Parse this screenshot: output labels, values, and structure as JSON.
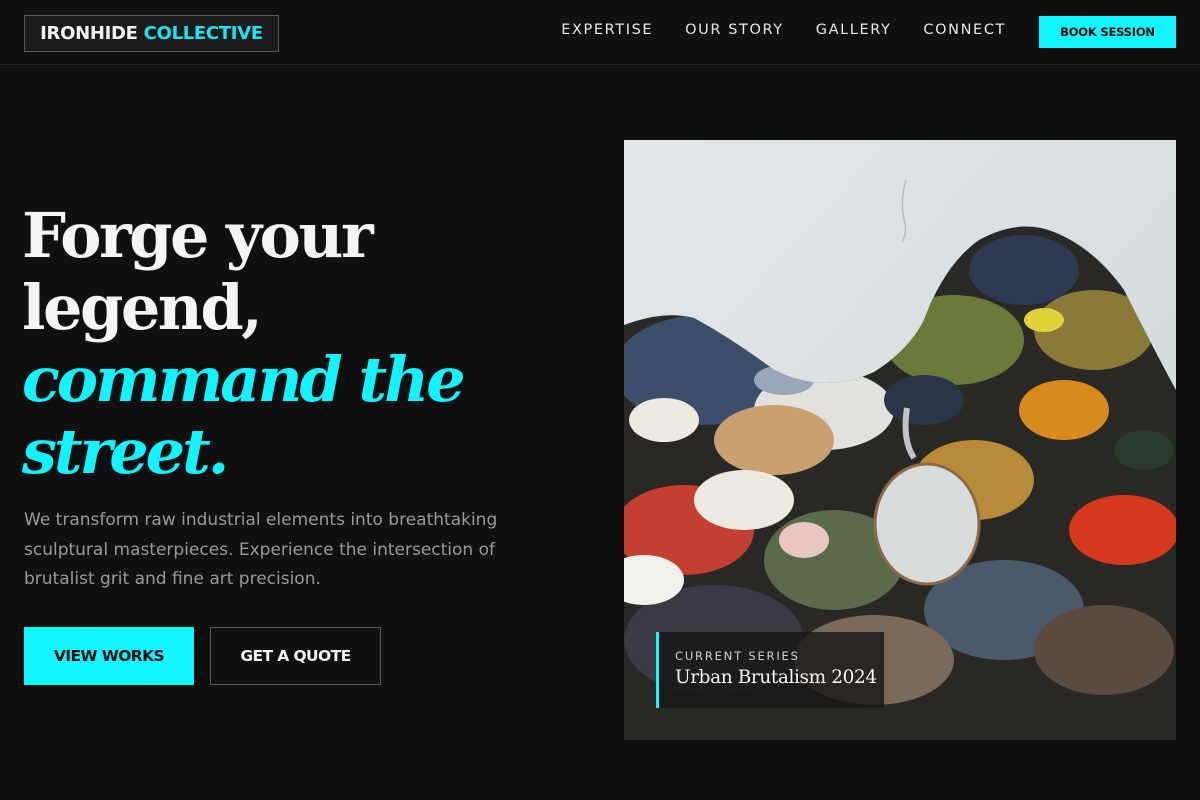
{
  "brand": {
    "name_part1": "IRONHIDE",
    "name_part2": "COLLECTIVE"
  },
  "nav": {
    "items": [
      {
        "label": "EXPERTISE"
      },
      {
        "label": "OUR STORY"
      },
      {
        "label": "GALLERY"
      },
      {
        "label": "CONNECT"
      }
    ],
    "cta_label": "BOOK SESSION"
  },
  "hero": {
    "headline_line1": "Forge your",
    "headline_line2": "legend,",
    "headline_accent1": "command the",
    "headline_accent2": "street.",
    "description": "We transform raw industrial elements into breathtaking sculptural masterpieces. Experience the intersection of brutalist grit and fine art precision.",
    "primary_button": "VIEW WORKS",
    "secondary_button": "GET A QUOTE"
  },
  "featured": {
    "image_icon": "paint-palette-artwork",
    "kicker": "CURRENT SERIES",
    "title": "Urban Brutalism 2024"
  },
  "colors": {
    "background": "#101010",
    "accent": "#14f6ff",
    "text": "#f2f2f2",
    "muted": "#9a9a9a"
  }
}
